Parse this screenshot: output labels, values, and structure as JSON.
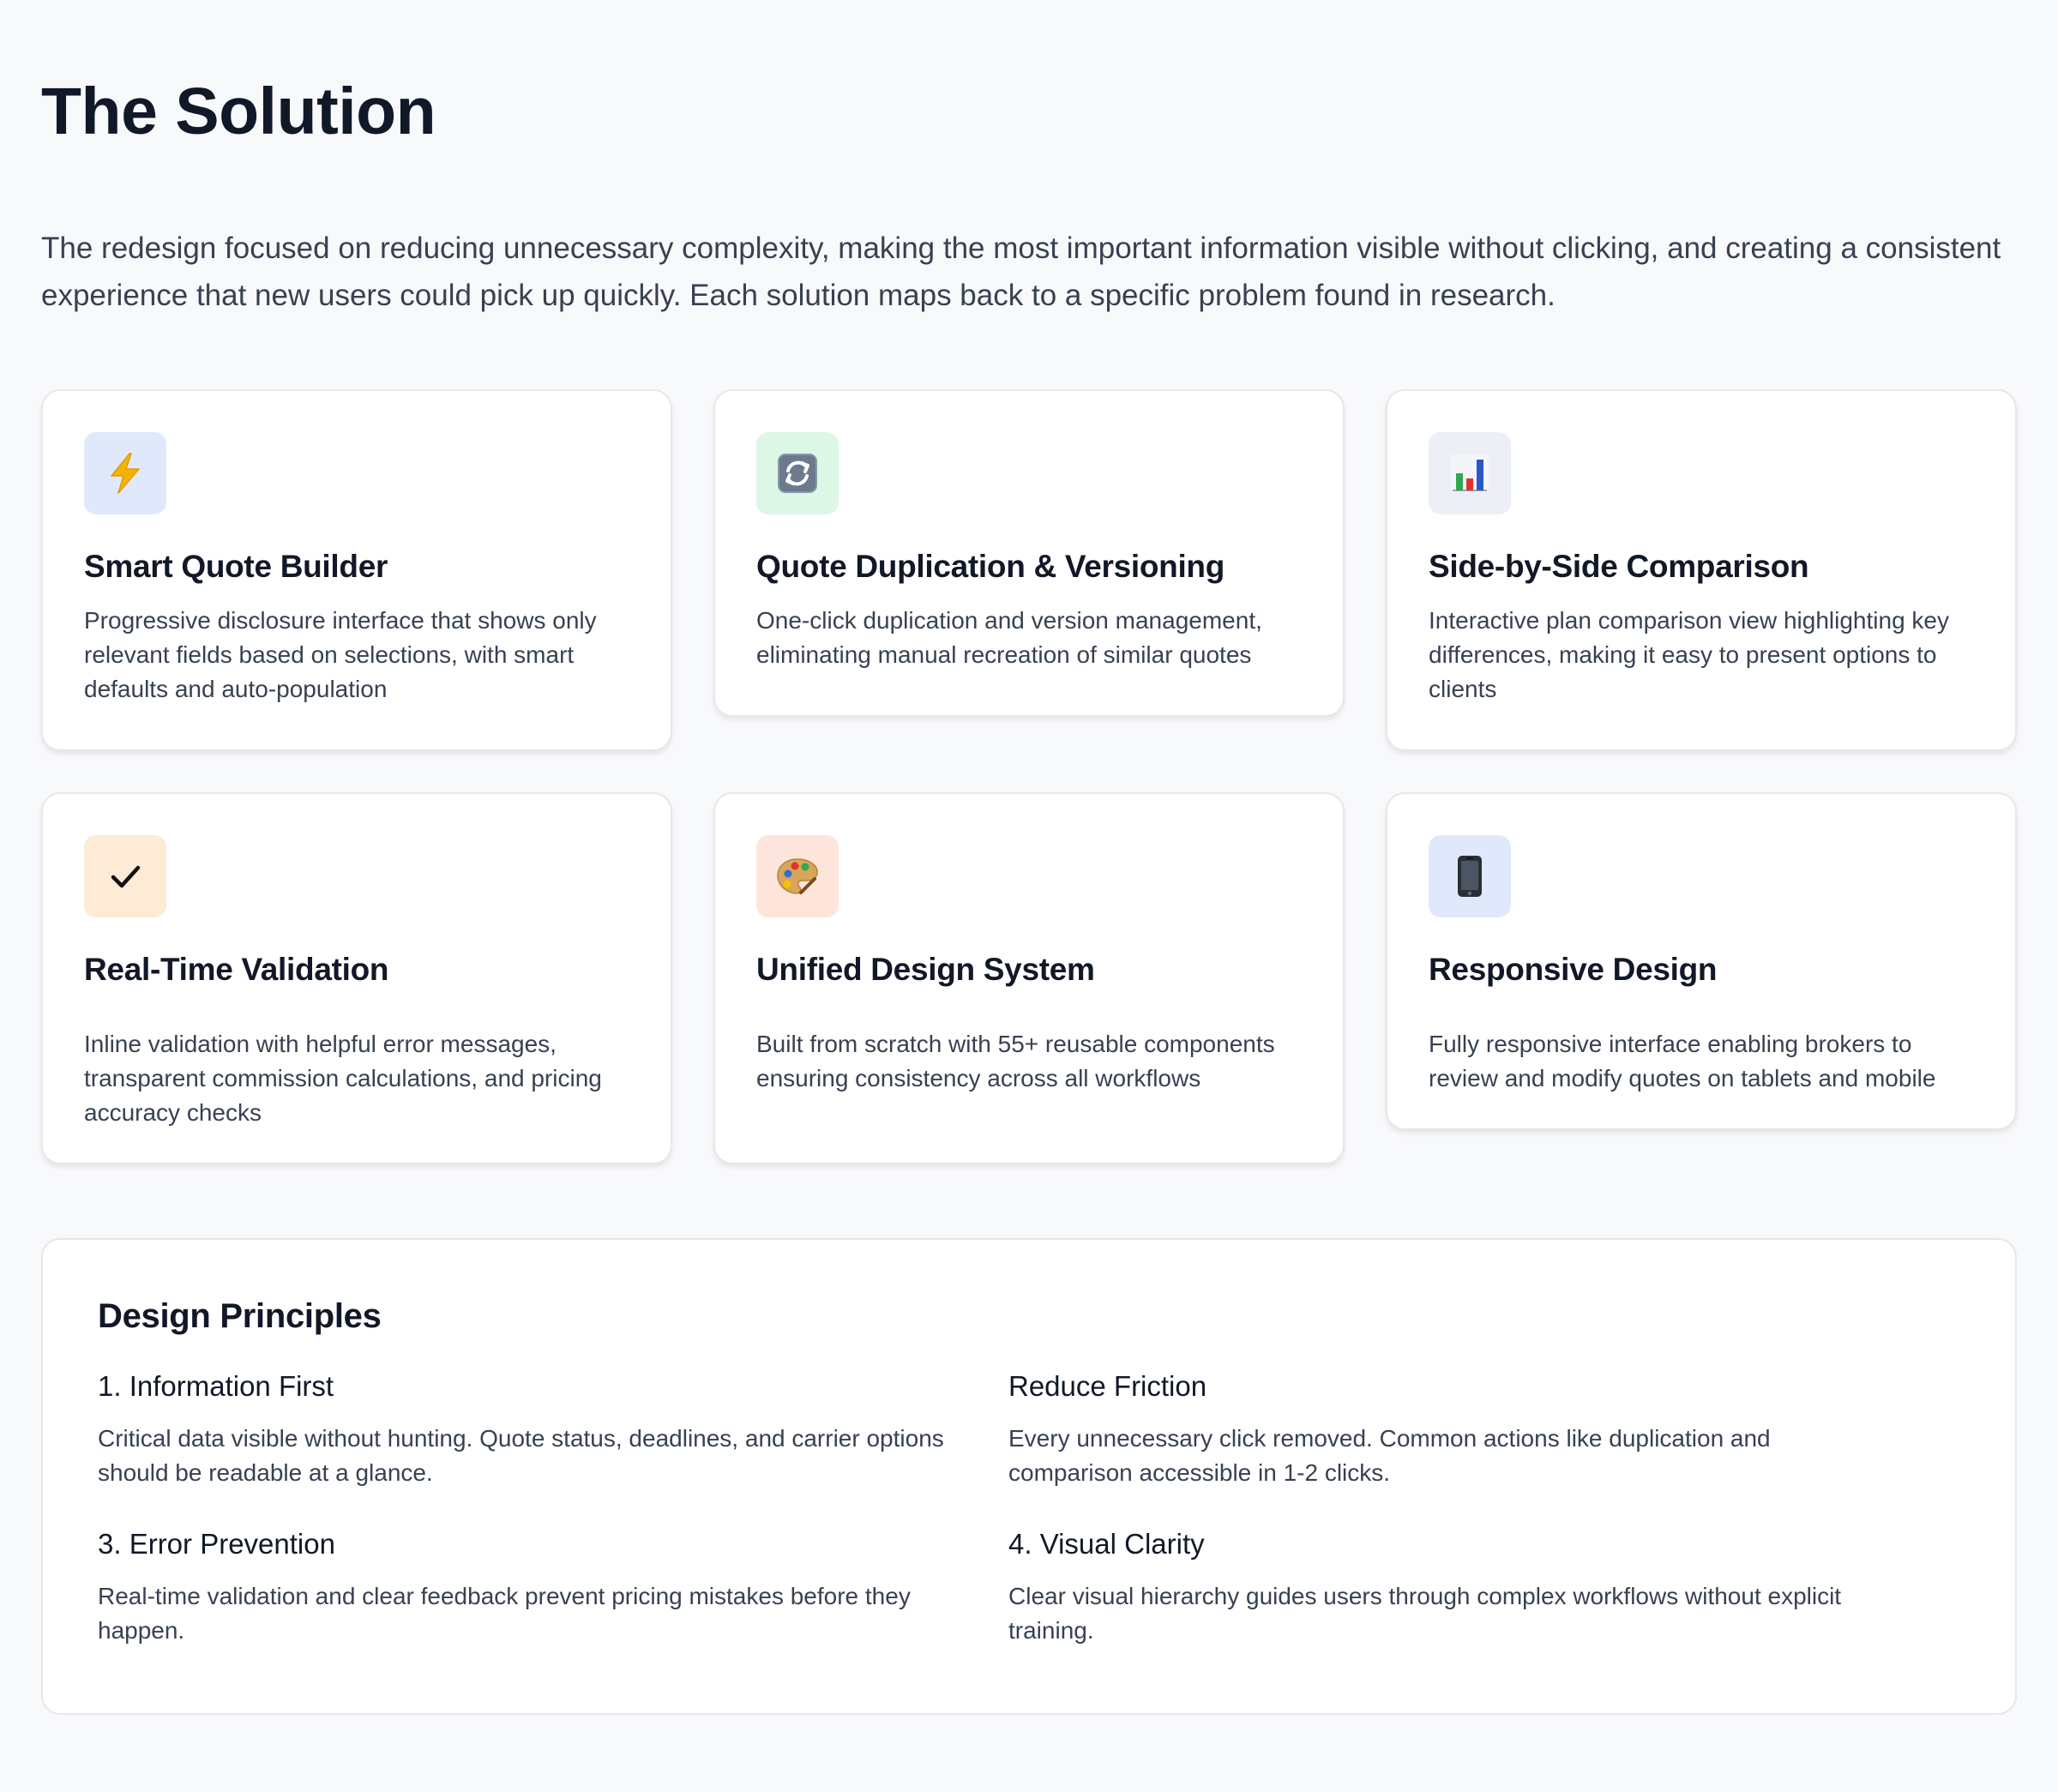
{
  "header": {
    "title": "The Solution",
    "intro": "The redesign focused on reducing unnecessary complexity, making the most important information visible without clicking, and creating a consistent experience that new users could pick up quickly. Each solution maps back to a specific problem found in research."
  },
  "cards": [
    {
      "title": "Smart Quote Builder",
      "description": "Progressive disclosure interface that shows only relevant fields based on selections, with smart defaults and auto-population",
      "icon": "lightning-icon",
      "icon_bg": "#e0e9fb"
    },
    {
      "title": "Quote Duplication & Versioning",
      "description": "One-click duplication and version management, eliminating manual recreation of similar quotes",
      "icon": "refresh-icon",
      "icon_bg": "#dcf7e6"
    },
    {
      "title": "Side-by-Side Comparison",
      "description": "Interactive plan comparison view highlighting key differences, making it easy to present options to clients",
      "icon": "bar-chart-icon",
      "icon_bg": "#eceff6"
    },
    {
      "title": "Real-Time Validation",
      "description": "Inline validation with helpful error messages, transparent commission calculations, and pricing accuracy checks",
      "icon": "checkmark-icon",
      "icon_bg": "#fdebd6"
    },
    {
      "title": "Unified Design System",
      "description": "Built from scratch with 55+ reusable components ensuring consistency across all workflows",
      "icon": "palette-icon",
      "icon_bg": "#fde5dc"
    },
    {
      "title": "Responsive Design",
      "description": "Fully responsive interface enabling brokers to review and modify quotes on tablets and mobile",
      "icon": "mobile-phone-icon",
      "icon_bg": "#e0e9fb"
    }
  ],
  "principles": {
    "title": "Design Principles",
    "items": [
      {
        "title": "1. Information First",
        "description": "Critical data visible without hunting. Quote status, deadlines, and carrier options should be readable at a glance."
      },
      {
        "title": "Reduce Friction",
        "description": "Every unnecessary click removed. Common actions like duplication and comparison accessible in 1-2 clicks."
      },
      {
        "title": "3. Error Prevention",
        "description": "Real-time validation and clear feedback prevent pricing mistakes before they happen."
      },
      {
        "title": "4. Visual Clarity",
        "description": "Clear visual hierarchy guides users through complex workflows without explicit training."
      }
    ]
  }
}
